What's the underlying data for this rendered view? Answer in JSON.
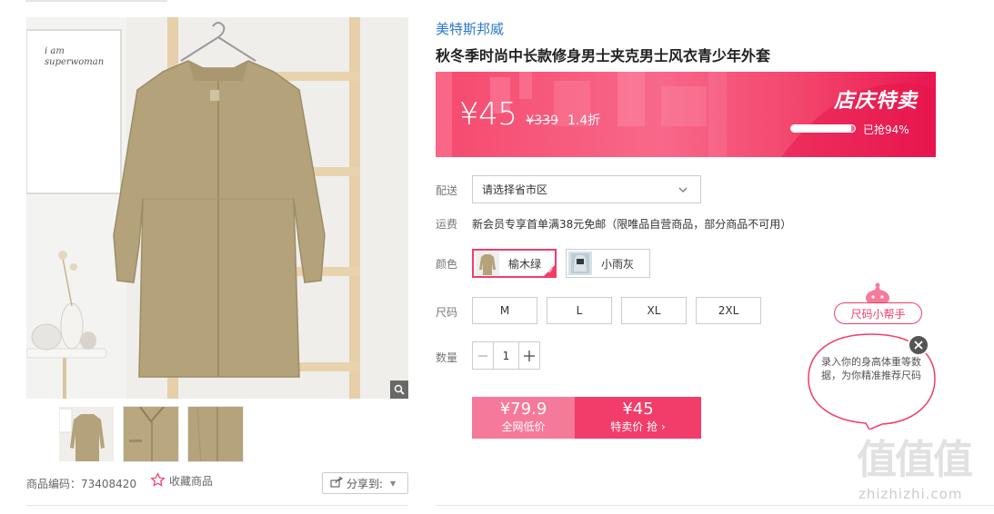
{
  "gallery": {
    "sku_label": "商品编码：73408420",
    "favorite_label": "收藏商品",
    "share_label": "分享到:",
    "wall_art_text": "i am superwoman"
  },
  "product": {
    "brand": "美特斯邦威",
    "title": "秋冬季时尚中长款修身男士夹克男士风衣青少年外套"
  },
  "promo": {
    "price": "¥45",
    "original_price": "¥339",
    "discount": "1.4折",
    "badge": "店庆特卖",
    "sold_fraction": 0.94,
    "sold_text": "已抢94%"
  },
  "delivery": {
    "label": "配送",
    "placeholder": "请选择省市区"
  },
  "shipping_fee": {
    "label": "运费",
    "text": "新会员专享首单满38元免邮（限唯品自营商品，部分商品不可用）"
  },
  "colors": {
    "label": "颜色",
    "options": [
      "榆木绿",
      "小雨灰"
    ],
    "selected": "榆木绿"
  },
  "sizes": {
    "label": "尺码",
    "options": [
      "M",
      "L",
      "XL",
      "2XL"
    ]
  },
  "quantity": {
    "label": "数量",
    "value": "1"
  },
  "buy": {
    "market_price": "¥79.9",
    "market_label": "全网低价",
    "sale_price": "¥45",
    "sale_label": "特卖价 抢 ›"
  },
  "size_helper": {
    "tag": "尺码小帮手",
    "message": "录入你的身高体重等数据，为你精准推荐尺码"
  },
  "watermark": {
    "logo": "值值值",
    "url": "zhizhizhi.com"
  },
  "theme": {
    "accent": "#f23d6a",
    "accent_light": "#f57a9a",
    "brand_link": "#2b78c9",
    "coat": "#b3a27a"
  }
}
